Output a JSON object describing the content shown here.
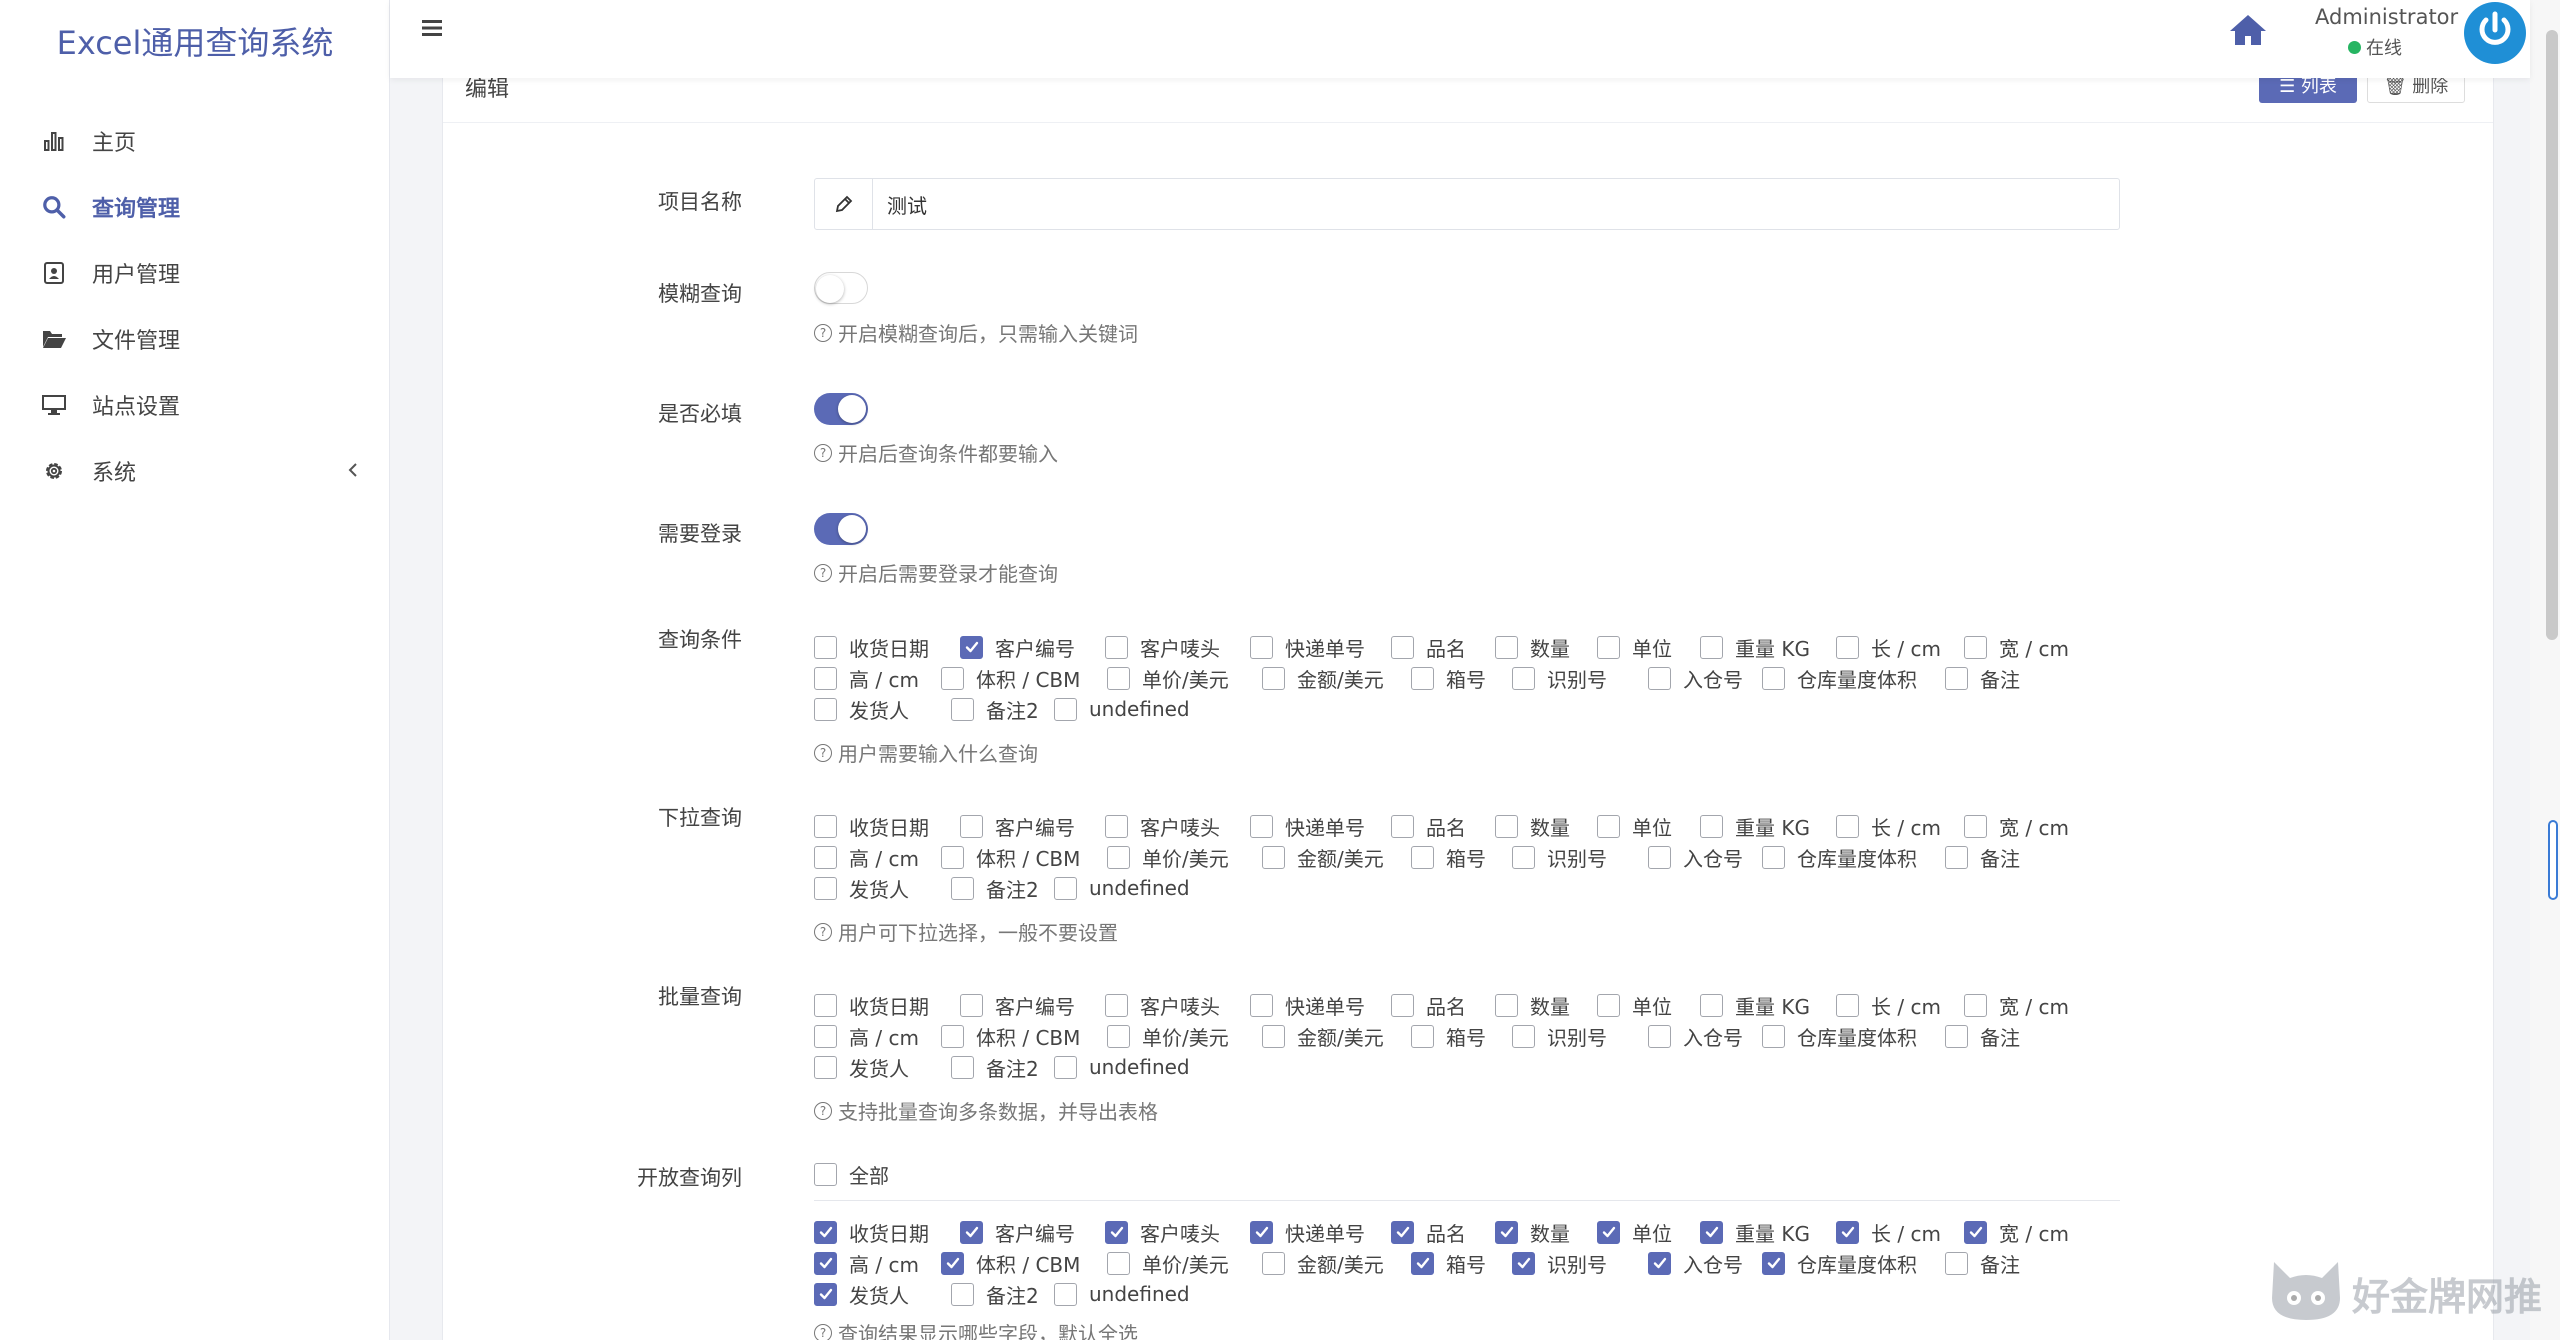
{
  "brand": "Excel通用查询系统",
  "nav": [
    {
      "label": "主页",
      "icon": "bar-chart-icon"
    },
    {
      "label": "查询管理",
      "icon": "search-icon",
      "active": true
    },
    {
      "label": "用户管理",
      "icon": "user-card-icon"
    },
    {
      "label": "文件管理",
      "icon": "folder-open-icon"
    },
    {
      "label": "站点设置",
      "icon": "monitor-icon"
    },
    {
      "label": "系统",
      "icon": "gear-icon"
    }
  ],
  "topbar": {
    "user_name": "Administrator",
    "status": "在线"
  },
  "card": {
    "title": "编辑",
    "list_btn": "☰ 列表",
    "delete_btn": "🗑 删除"
  },
  "form": {
    "project_name": {
      "label": "项目名称",
      "value": "测试"
    },
    "fuzzy": {
      "label": "模糊查询",
      "on": false,
      "help": "开启模糊查询后，只需输入关键词"
    },
    "required": {
      "label": "是否必填",
      "on": true,
      "help": "开启后查询条件都要输入"
    },
    "login": {
      "label": "需要登录",
      "on": true,
      "help": "开启后需要登录才能查询"
    },
    "query_conditions": {
      "label": "查询条件",
      "checked": [
        false,
        true,
        false,
        false,
        false,
        false,
        false,
        false,
        false,
        false,
        false,
        false,
        false,
        false,
        false,
        false,
        false,
        false,
        false,
        false,
        false
      ],
      "help": "用户需要输入什么查询"
    },
    "dropdown_query": {
      "label": "下拉查询",
      "checked": [
        false,
        false,
        false,
        false,
        false,
        false,
        false,
        false,
        false,
        false,
        false,
        false,
        false,
        false,
        false,
        false,
        false,
        false,
        false,
        false,
        false
      ],
      "help": "用户可下拉选择，一般不要设置"
    },
    "batch_query": {
      "label": "批量查询",
      "checked": [
        false,
        false,
        false,
        false,
        false,
        false,
        false,
        false,
        false,
        false,
        false,
        false,
        false,
        false,
        false,
        false,
        false,
        false,
        false,
        false,
        false
      ],
      "help": "支持批量查询多条数据，并导出表格"
    },
    "open_columns": {
      "label": "开放查询列",
      "all_label": "全部",
      "all_checked": false,
      "checked": [
        true,
        true,
        true,
        true,
        true,
        true,
        true,
        true,
        true,
        true,
        true,
        true,
        false,
        false,
        true,
        true,
        true,
        true,
        false,
        true,
        false
      ],
      "help": "查询结果显示哪些字段，默认全选"
    }
  },
  "fields": [
    "收货日期",
    "客户编号",
    "客户唛头",
    "快递单号",
    "品名",
    "数量",
    "单位",
    "重量 KG",
    "长 / cm",
    "宽 / cm",
    "高 / cm",
    "体积 / CBM",
    "单价/美元",
    "金额/美元",
    "箱号",
    "识别号",
    "入仓号",
    "仓库量度体积",
    "备注",
    "发货人",
    "备注2",
    "undefined"
  ],
  "watermark": "好金牌网推"
}
